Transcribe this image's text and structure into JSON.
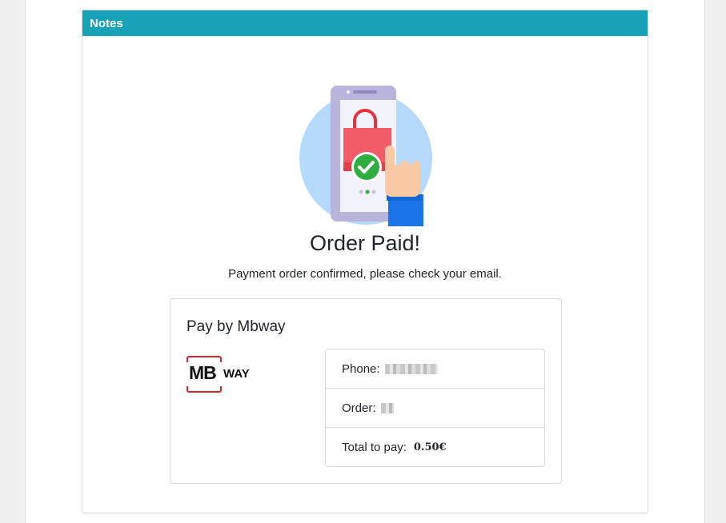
{
  "notes": {
    "header": "Notes"
  },
  "confirmation": {
    "title": "Order Paid!",
    "message": "Payment order confirmed, please check your email."
  },
  "payment": {
    "title": "Pay by Mbway",
    "logo": {
      "mb": "MB",
      "way": "WAY"
    },
    "phone_label": "Phone:",
    "order_label": "Order:",
    "total_label": "Total to pay:",
    "total_value": "0.50€"
  },
  "colors": {
    "header_bg": "#17a2b8",
    "mbway_red": "#d7262c"
  }
}
